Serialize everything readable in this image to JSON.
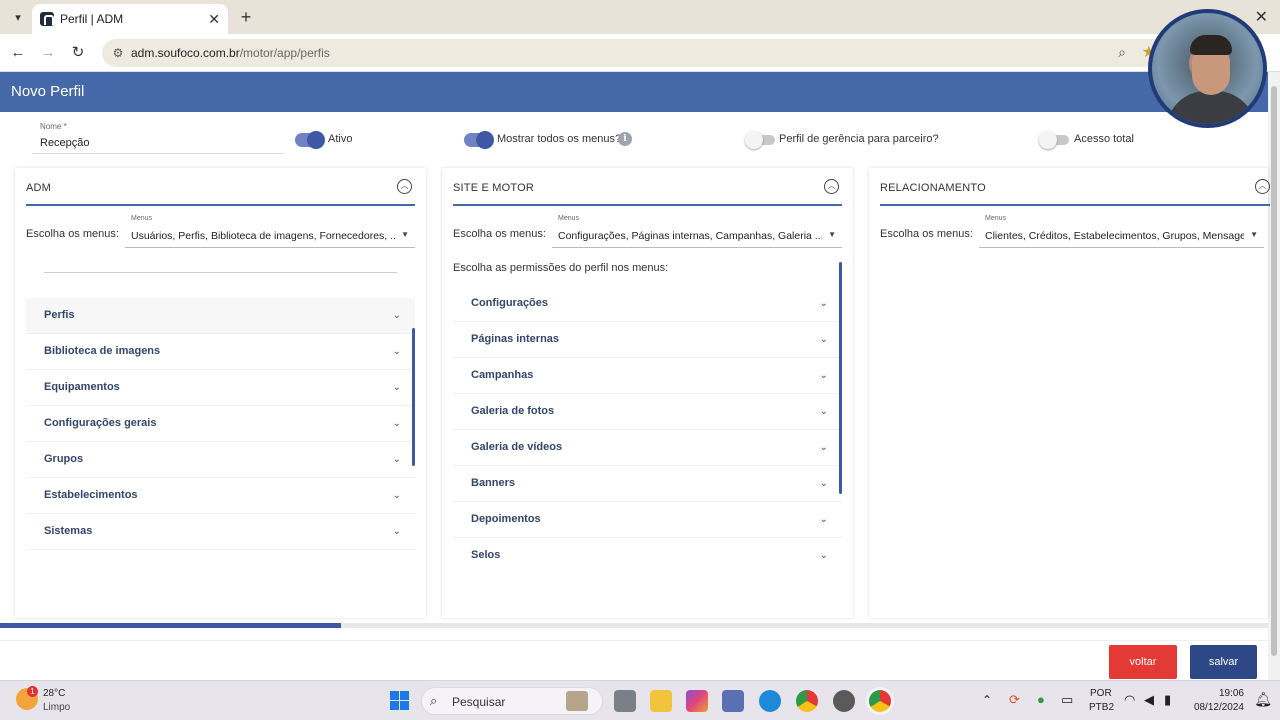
{
  "browser": {
    "tab_title": "Perfil | ADM",
    "url_host": "adm.soufoco.com.br",
    "url_path": "/motor/app/perfis"
  },
  "header": {
    "title": "Novo Perfil"
  },
  "form": {
    "name_label": "Nome *",
    "name_value": "Recepção",
    "toggles": [
      {
        "label": "Ativo",
        "on": true
      },
      {
        "label": "Mostrar todos os menus?",
        "on": true
      },
      {
        "label": "Perfil de gerência para parceiro?",
        "on": false
      },
      {
        "label": "Acesso total",
        "on": false
      }
    ]
  },
  "panels": [
    {
      "title": "ADM",
      "menus_label": "Escolha os menus:",
      "select_label": "Menus",
      "select_value": "Usuários, Perfis, Biblioteca de imagens, Fornecedores, ...",
      "items": [
        "Perfis",
        "Biblioteca de imagens",
        "Equipamentos",
        "Configurações gerais",
        "Grupos",
        "Estabelecimentos",
        "Sistemas"
      ]
    },
    {
      "title": "SITE E MOTOR",
      "menus_label": "Escolha os menus:",
      "select_label": "Menus",
      "select_value": "Configurações, Páginas internas, Campanhas, Galeria ...",
      "perm_text": "Escolha as permissões do perfil nos menus:",
      "items": [
        "Configurações",
        "Páginas internas",
        "Campanhas",
        "Galeria de fotos",
        "Galeria de vídeos",
        "Banners",
        "Depoimentos",
        "Selos"
      ]
    },
    {
      "title": "RELACIONAMENTO",
      "menus_label": "Escolha os menus:",
      "select_label": "Menus",
      "select_value": "Clientes, Créditos, Estabelecimentos, Grupos, Mensage...",
      "items": []
    }
  ],
  "footer": {
    "back_label": "voltar",
    "save_label": "salvar"
  },
  "taskbar": {
    "weather_temp": "28°C",
    "weather_cond": "Limpo",
    "weather_badge": "1",
    "search_placeholder": "Pesquisar",
    "lang_top": "POR",
    "lang_bottom": "PTB2",
    "time": "19:06",
    "date": "08/12/2024"
  },
  "colors": {
    "header_blue": "#4568a8",
    "accent_blue": "#3f58a6",
    "back_red": "#e53935",
    "save_blue": "#2d4787"
  }
}
